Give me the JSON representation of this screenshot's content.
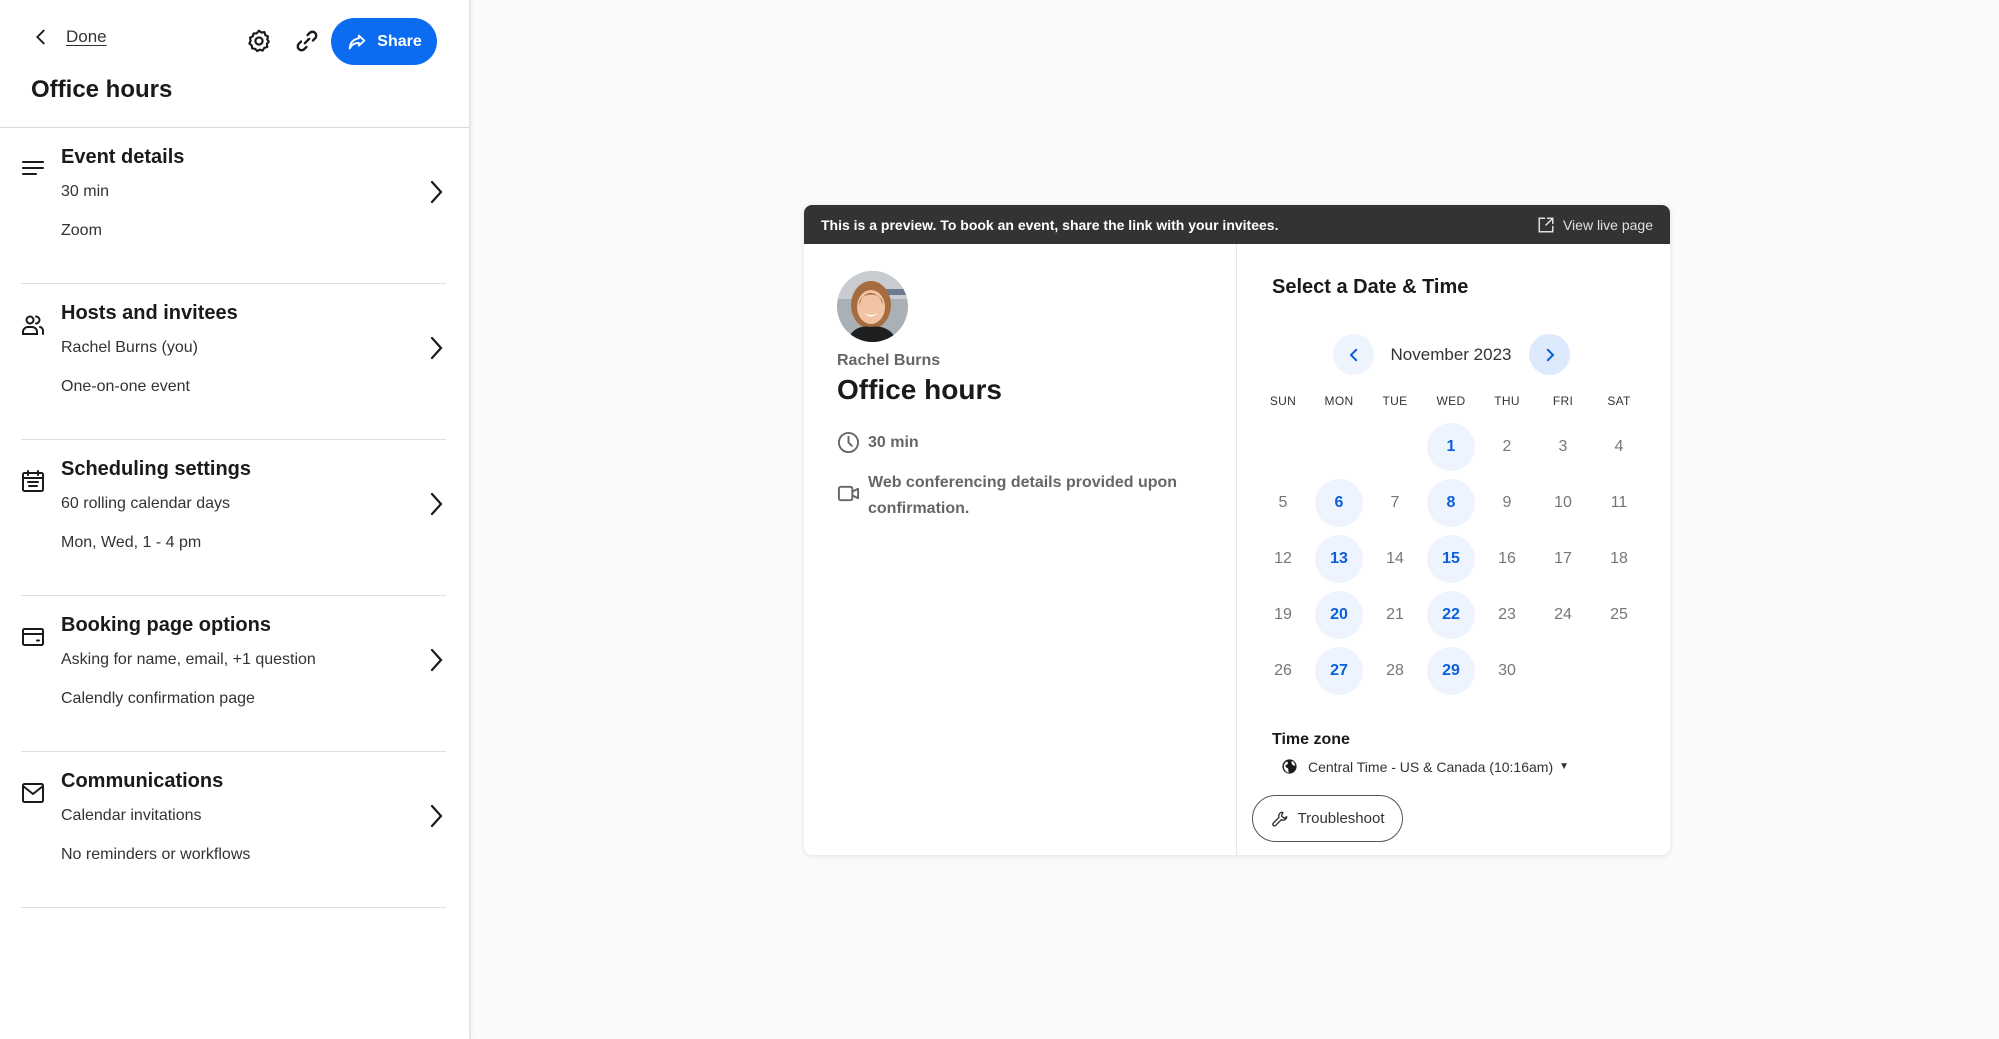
{
  "sidebar": {
    "back_label": "Done",
    "share_label": "Share",
    "title": "Office hours",
    "sections": [
      {
        "title": "Event details",
        "line1": "30 min",
        "line2": "Zoom",
        "icon": "lines-icon"
      },
      {
        "title": "Hosts and invitees",
        "line1": "Rachel Burns (you)",
        "line2": "One-on-one event",
        "icon": "people-icon"
      },
      {
        "title": "Scheduling settings",
        "line1": "60 rolling calendar days",
        "line2": "Mon, Wed, 1 - 4 pm",
        "icon": "calendar-icon"
      },
      {
        "title": "Booking page options",
        "line1": "Asking for name, email, +1 question",
        "line2": "Calendly confirmation page",
        "icon": "card-icon"
      },
      {
        "title": "Communications",
        "line1": "Calendar invitations",
        "line2": "No reminders or workflows",
        "icon": "mail-icon"
      }
    ]
  },
  "preview": {
    "banner_text": "This is a preview. To book an event, share the link with your invitees.",
    "view_live_label": "View live page",
    "host_name": "Rachel Burns",
    "event_title": "Office hours",
    "duration": "30 min",
    "conferencing": "Web conferencing details provided upon confirmation.",
    "select_title": "Select a Date & Time",
    "month_label": "November 2023",
    "weekdays": [
      "SUN",
      "MON",
      "TUE",
      "WED",
      "THU",
      "FRI",
      "SAT"
    ],
    "weeks": [
      [
        null,
        null,
        null,
        1,
        2,
        3,
        4
      ],
      [
        5,
        6,
        7,
        8,
        9,
        10,
        11
      ],
      [
        12,
        13,
        14,
        15,
        16,
        17,
        18
      ],
      [
        19,
        20,
        21,
        22,
        23,
        24,
        25
      ],
      [
        26,
        27,
        28,
        29,
        30,
        null,
        null
      ]
    ],
    "available_days": [
      1,
      6,
      8,
      13,
      15,
      20,
      22,
      27,
      29
    ],
    "timezone_label": "Time zone",
    "timezone_value": "Central Time - US & Canada (10:16am)",
    "troubleshoot_label": "Troubleshoot"
  },
  "colors": {
    "accent": "#0b6cf2",
    "available_day_text": "#0b5fd8",
    "available_day_bg": "#eef4fe",
    "banner_bg": "#333333",
    "page_bg": "#fafafa"
  }
}
